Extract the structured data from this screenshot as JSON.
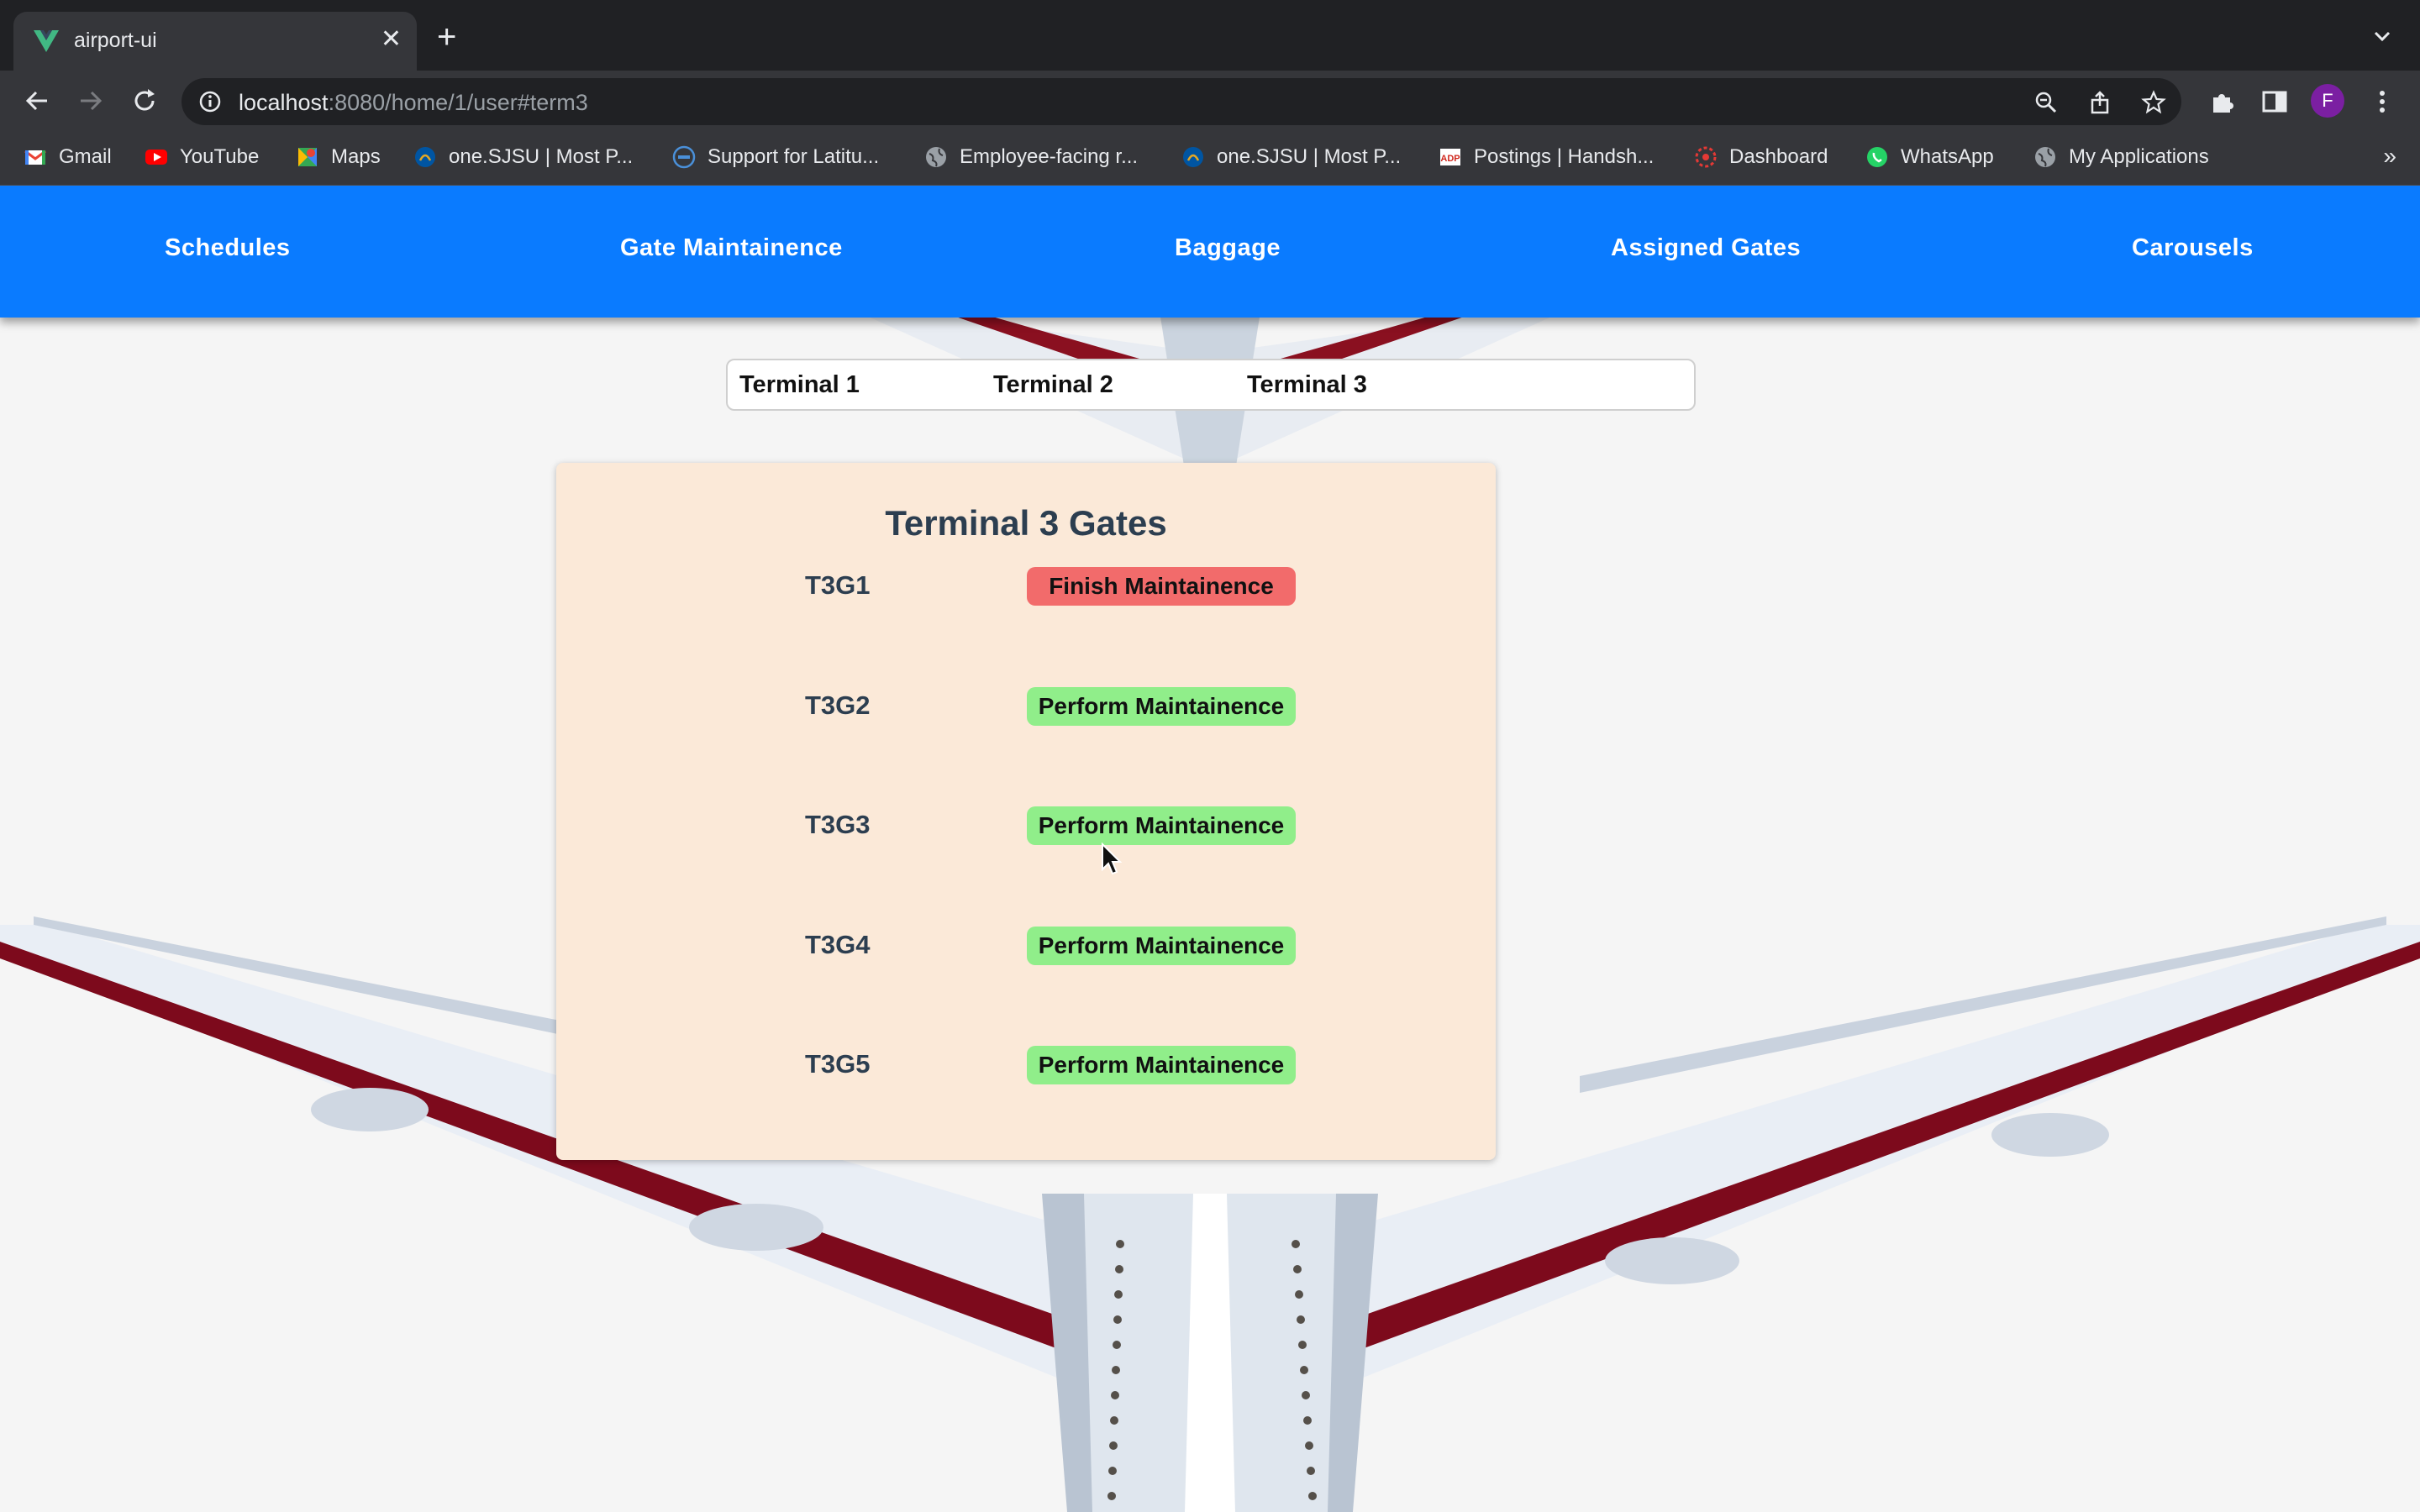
{
  "browser": {
    "tab_title": "airport-ui",
    "url_host": "localhost",
    "url_path": ":8080/home/1/user#term3",
    "profile_initial": "F",
    "bookmarks": [
      {
        "label": "Gmail",
        "icon": "gmail-icon"
      },
      {
        "label": "YouTube",
        "icon": "youtube-icon"
      },
      {
        "label": "Maps",
        "icon": "maps-icon"
      },
      {
        "label": "one.SJSU | Most P...",
        "icon": "sjsu-icon"
      },
      {
        "label": "Support for Latitu...",
        "icon": "dell-icon"
      },
      {
        "label": "Employee-facing r...",
        "icon": "globe-icon"
      },
      {
        "label": "one.SJSU | Most P...",
        "icon": "sjsu-icon"
      },
      {
        "label": "Postings | Handsh...",
        "icon": "adp-icon"
      },
      {
        "label": "Dashboard",
        "icon": "dashboard-icon"
      },
      {
        "label": "WhatsApp",
        "icon": "whatsapp-icon"
      },
      {
        "label": "My Applications",
        "icon": "globe-icon"
      }
    ],
    "more_bookmarks": "»"
  },
  "nav": {
    "items": [
      "Schedules",
      "Gate Maintainence",
      "Baggage",
      "Assigned Gates",
      "Carousels"
    ]
  },
  "terminals": {
    "tabs": [
      "Terminal 1",
      "Terminal 2",
      "Terminal 3"
    ]
  },
  "panel": {
    "title": "Terminal 3 Gates",
    "gates": [
      {
        "name": "T3G1",
        "action": "Finish Maintainence",
        "status": "finish"
      },
      {
        "name": "T3G2",
        "action": "Perform Maintainence",
        "status": "perform"
      },
      {
        "name": "T3G3",
        "action": "Perform Maintainence",
        "status": "perform"
      },
      {
        "name": "T3G4",
        "action": "Perform Maintainence",
        "status": "perform"
      },
      {
        "name": "T3G5",
        "action": "Perform Maintainence",
        "status": "perform"
      }
    ]
  },
  "colors": {
    "nav_bg": "#0a7bff",
    "finish": "#f26b6b",
    "perform": "#90ee8a",
    "panel_bg": "#fbe9d8"
  }
}
